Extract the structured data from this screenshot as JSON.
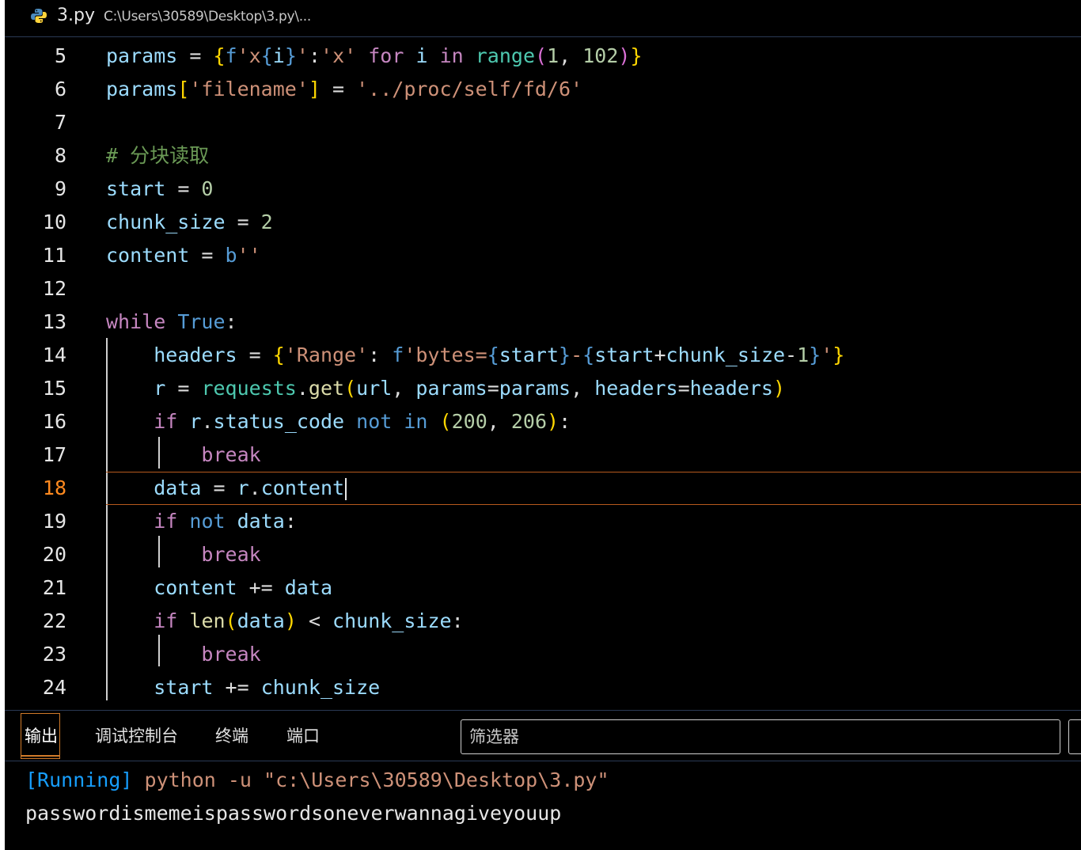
{
  "titlebar": {
    "filename": "3.py",
    "path": "C:\\Users\\30589\\Desktop\\3.py\\..."
  },
  "editor": {
    "active_line": 18,
    "line_numbers": [
      "5",
      "6",
      "7",
      "8",
      "9",
      "10",
      "11",
      "12",
      "13",
      "14",
      "15",
      "16",
      "17",
      "18",
      "19",
      "20",
      "21",
      "22",
      "23",
      "24"
    ]
  },
  "panel": {
    "tabs": [
      "输出",
      "调试控制台",
      "终端",
      "端口"
    ],
    "active_tab": "输出",
    "filter_placeholder": "筛选器",
    "running_prefix": "[Running]",
    "running_command": " python -u \"c:\\Users\\30589\\Desktop\\3.py\"",
    "output_text": "passwordismemeispasswordsoneverwannagiveyouup"
  }
}
